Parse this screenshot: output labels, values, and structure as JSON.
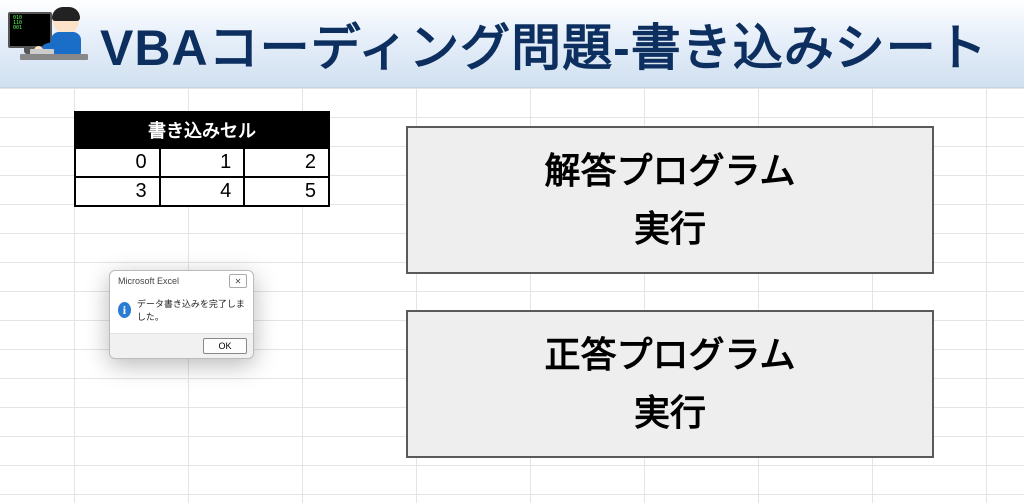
{
  "header": {
    "title": "VBAコーディング問題-書き込みシート"
  },
  "table": {
    "header": "書き込みセル",
    "rows": [
      [
        "0",
        "1",
        "2"
      ],
      [
        "3",
        "4",
        "5"
      ]
    ]
  },
  "buttons": {
    "answer_run_l1": "解答プログラム",
    "answer_run_l2": "実行",
    "correct_run_l1": "正答プログラム",
    "correct_run_l2": "実行"
  },
  "msgbox": {
    "title": "Microsoft Excel",
    "message": "データ書き込みを完了しました。",
    "ok": "OK"
  }
}
